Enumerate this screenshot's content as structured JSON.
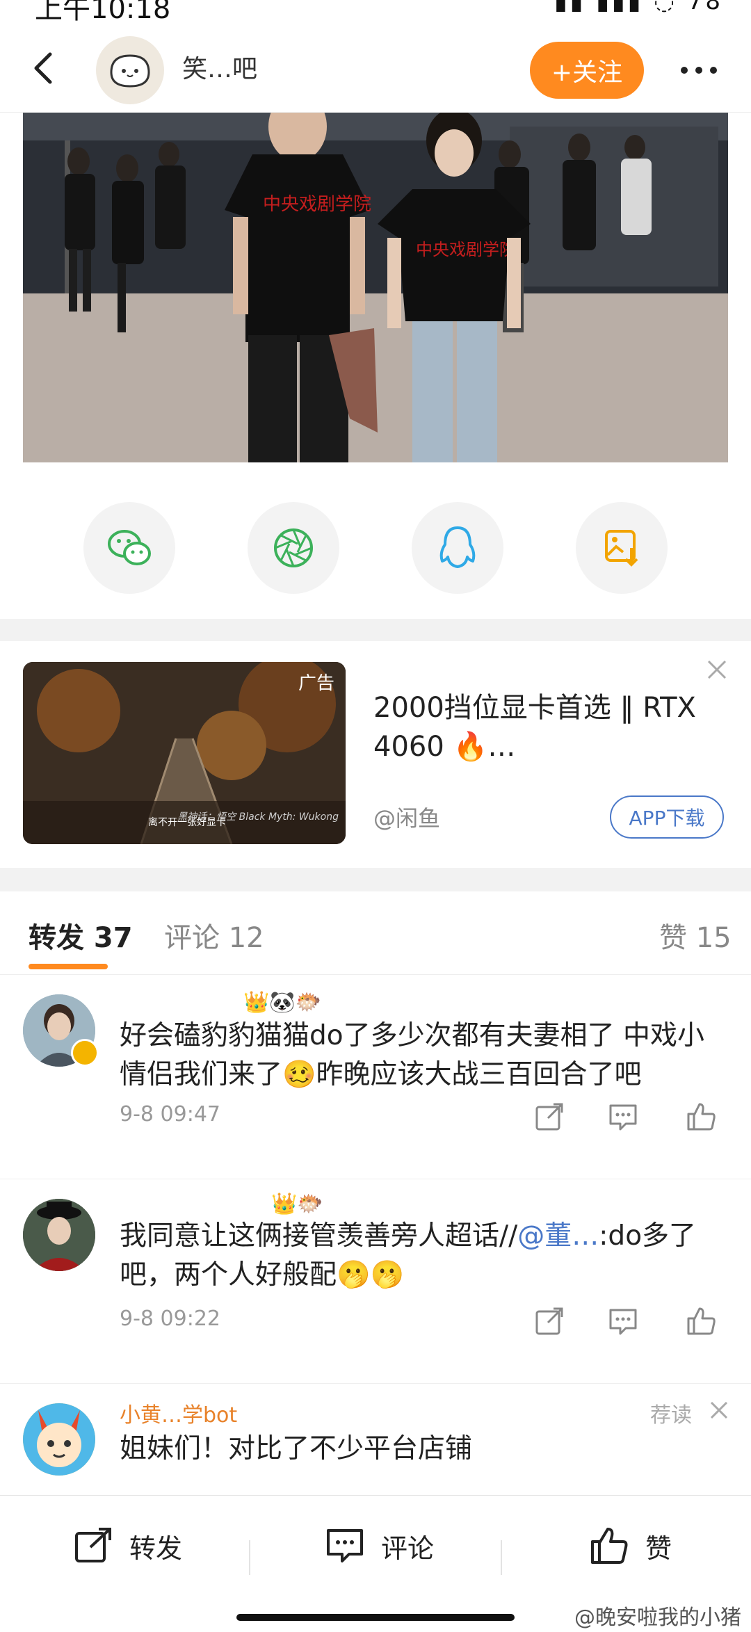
{
  "status_bar": {
    "time": "上午10:18",
    "icons": "▮▮ ▮▮▮ ◌ 78"
  },
  "nav": {
    "name": "笑…吧",
    "follow_label": "+关注"
  },
  "share": {
    "targets": [
      {
        "name": "wechat-icon",
        "color": "#3cb15a"
      },
      {
        "name": "moments-icon",
        "color": "#3cb15a"
      },
      {
        "name": "qq-icon",
        "color": "#2fa9e6"
      },
      {
        "name": "save-image-icon",
        "color": "#f2a400"
      }
    ]
  },
  "ad": {
    "tag": "广告",
    "caption": "离不开一张好显卡",
    "caption2": "黑神话：悟空\nBlack Myth: Wukong",
    "title": "2000挡位显卡首选 ‖ RTX 4060 🔥…",
    "source": "@闲鱼",
    "download_label": "APP下载"
  },
  "tabs": {
    "repost_label": "转发 37",
    "comment_label": "评论 12",
    "like_label": "赞 15"
  },
  "comments": [
    {
      "emojis": "👑🐼🐡",
      "text": "好会磕豹豹猫猫do了多少次都有夫妻相了 中戏小情侣我们来了🥴昨晚应该大战三百回合了吧",
      "time": "9-8 09:47"
    },
    {
      "emojis": "👑🐡",
      "text_pre": "我同意让这俩接管羡善旁人超话//",
      "mention": "@董…",
      "text_post": ":do多了吧，两个人好般配🫢🫢",
      "time": "9-8 09:22"
    },
    {
      "name": "小黄…学bot",
      "tag": "荐读",
      "text": "姐妹们！对比了不少平台店铺"
    }
  ],
  "bottom_bar": {
    "repost_label": "转发",
    "comment_label": "评论",
    "like_label": "赞"
  },
  "watermark": "@晚安啦我的小猪"
}
